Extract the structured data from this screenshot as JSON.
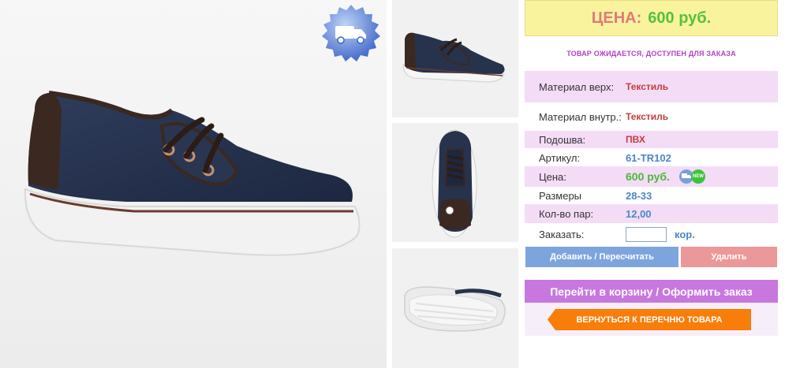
{
  "product_images": {
    "main_alt": "Shoe main photo",
    "thumb_1_alt": "Shoe side view",
    "thumb_2_alt": "Shoe top view",
    "thumb_3_alt": "Shoe sole view"
  },
  "delivery_badge": {
    "icon": "truck-icon"
  },
  "price_banner": {
    "label": "ЦЕНА:",
    "value": "600 руб."
  },
  "status_note": "ТОВАР ОЖИДАЕТСЯ, ДОСТУПЕН ДЛЯ ЗАКАЗА",
  "specs": [
    {
      "label": "Материал верх:",
      "value": "Текстиль"
    },
    {
      "label": "Материал внутр.:",
      "value": "Текстиль"
    },
    {
      "label": "Подошва:",
      "value": "ПВХ"
    },
    {
      "label": "Артикул:",
      "value": "61-TR102"
    },
    {
      "label": "Цена:",
      "value": "600 руб."
    },
    {
      "label": "Размеры",
      "value": "28-33"
    },
    {
      "label": "Кол-во пар:",
      "value": "12,00"
    }
  ],
  "order": {
    "label": "Заказать:",
    "input_value": "",
    "unit": "кор."
  },
  "buttons": {
    "add": "Добавить / Пересчитать",
    "delete": "Удалить",
    "checkout": "Перейти в корзину / Оформить заказ",
    "back": "ВЕРНУТЬСЯ К ПЕРЕЧНЮ ТОВАРА"
  },
  "price_icons": {
    "delivery": "delivery-mini-icon",
    "new": "NEW"
  },
  "colors": {
    "banner_bg": "#faf39e",
    "label_pink": "#e07a78",
    "price_green": "#53c23d",
    "row_pink": "#f4dcf7",
    "value_red": "#c23d3d",
    "value_blue": "#4a88c5",
    "btn_blue": "#7ea4dd",
    "btn_red": "#ec9898",
    "btn_purple": "#c877df",
    "btn_orange": "#f97d09"
  }
}
